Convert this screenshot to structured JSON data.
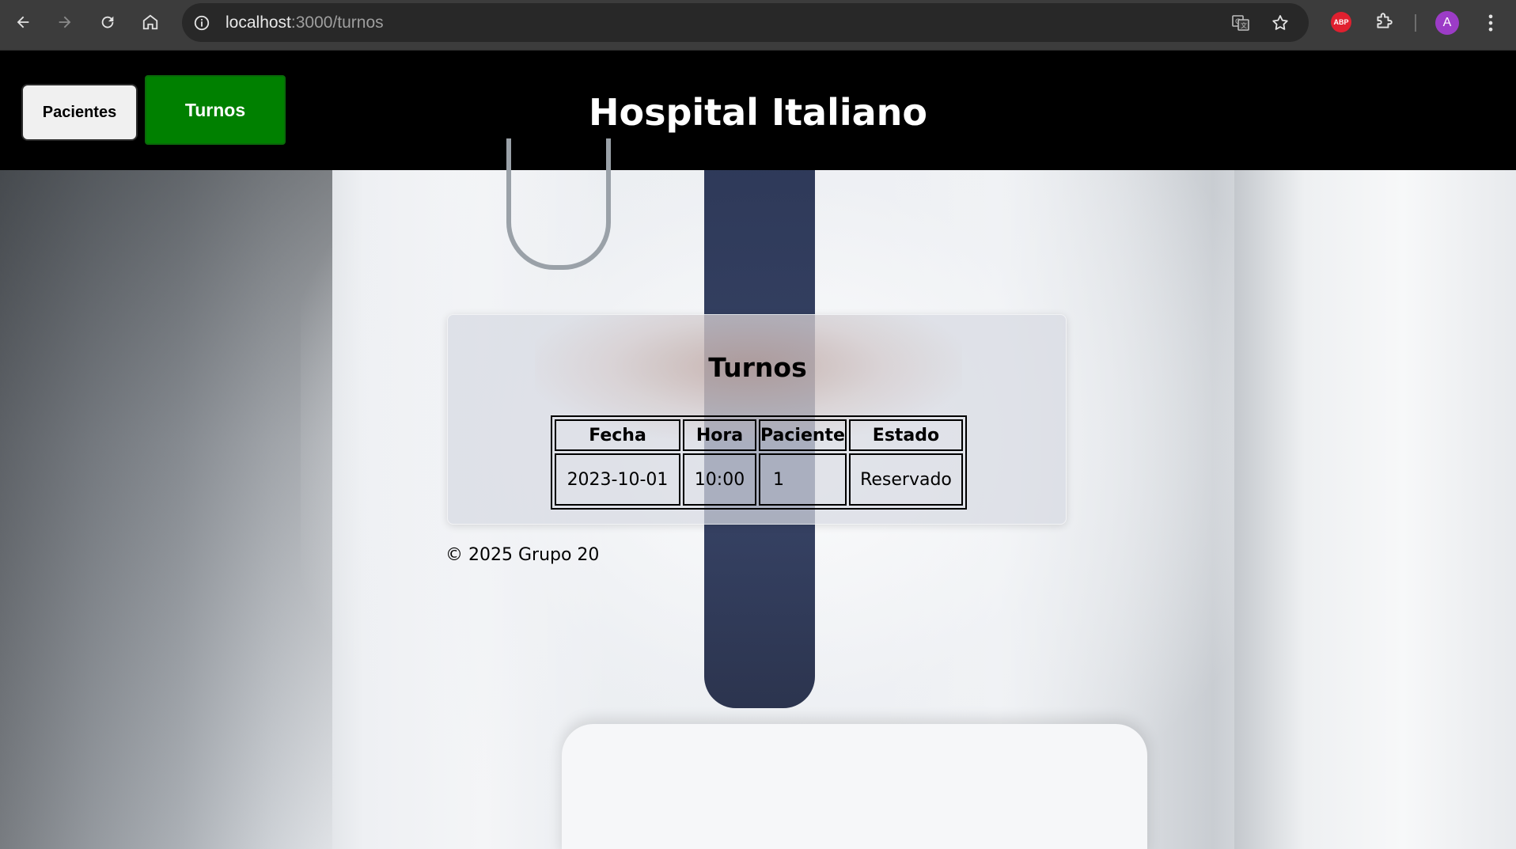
{
  "browser": {
    "url_host": "localhost",
    "url_path": ":3000/turnos",
    "extension_badge": "ABP",
    "profile_initial": "A"
  },
  "header": {
    "title": "Hospital Italiano",
    "nav": {
      "pacientes_label": "Pacientes",
      "turnos_label": "Turnos"
    },
    "colors": {
      "background": "#000000",
      "turnos_active": "#008000"
    }
  },
  "card": {
    "title": "Turnos",
    "table": {
      "headers": [
        "Fecha",
        "Hora",
        "Paciente",
        "Estado"
      ],
      "rows": [
        [
          "2023-10-01",
          "10:00",
          "1",
          "Reservado"
        ]
      ]
    }
  },
  "footer": {
    "text": "© 2025 Grupo 20"
  },
  "icons": {
    "back": "arrow-left-icon",
    "forward": "arrow-right-icon",
    "reload": "reload-icon",
    "home": "home-icon",
    "site_info": "info-icon",
    "translate": "translate-icon",
    "bookmark": "star-icon",
    "extensions": "puzzle-icon",
    "menu": "kebab-menu-icon"
  }
}
